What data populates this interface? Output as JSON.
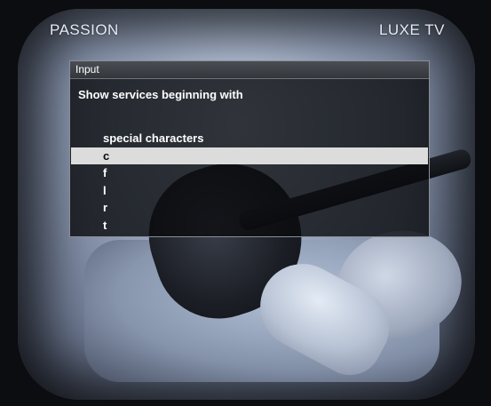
{
  "channel": {
    "left_label": "PASSION",
    "right_label": "LUXE TV"
  },
  "dialog": {
    "title": "Input",
    "prompt": "Show services beginning with",
    "selected_index": 1,
    "options": [
      "special characters",
      "c",
      "f",
      "l",
      "r",
      "t"
    ]
  },
  "colors": {
    "dialog_background": "#0a0b0e",
    "selection_highlight": "#dcdcdc",
    "text": "#ffffff"
  }
}
